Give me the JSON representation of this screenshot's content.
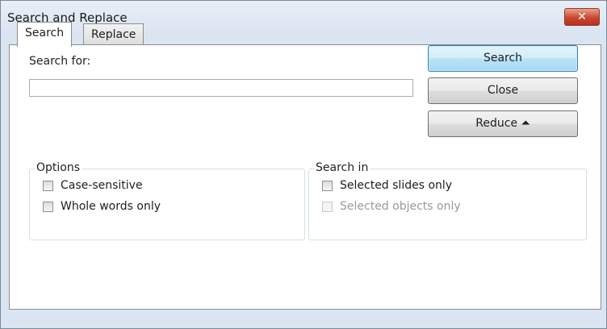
{
  "window": {
    "title": "Search and Replace",
    "close_glyph": "✕"
  },
  "tabs": [
    {
      "label": "Search",
      "active": true
    },
    {
      "label": "Replace",
      "active": false
    }
  ],
  "search": {
    "label": "Search for:",
    "value": ""
  },
  "buttons": {
    "search": "Search",
    "close": "Close",
    "reduce": "Reduce ⏶"
  },
  "options": {
    "legend": "Options",
    "items": [
      {
        "label": "Case-sensitive",
        "checked": false,
        "enabled": true
      },
      {
        "label": "Whole words only",
        "checked": false,
        "enabled": true
      }
    ]
  },
  "search_in": {
    "legend": "Search in",
    "items": [
      {
        "label": "Selected slides only",
        "checked": false,
        "enabled": true
      },
      {
        "label": "Selected objects only",
        "checked": false,
        "enabled": false
      }
    ]
  },
  "colors": {
    "accent": "#3c7fb1",
    "titlebar": "#dbe5f1",
    "close": "#c9472f"
  }
}
